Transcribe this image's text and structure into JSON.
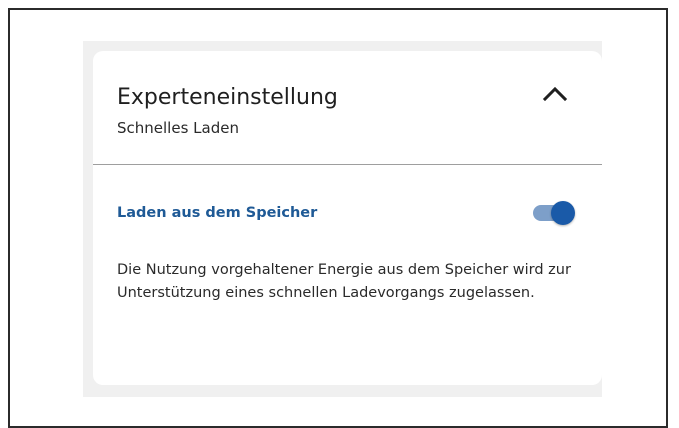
{
  "settings_card": {
    "title": "Experteneinstellung",
    "subtitle": "Schnelles Laden",
    "expanded": true,
    "collapse_icon": "chevron-up-icon",
    "option": {
      "label": "Laden aus dem Speicher",
      "enabled": true,
      "description": "Die Nutzung vorgehaltener Energie aus dem Speicher wird zur Unterstützung eines schnellen Ladevorgangs zugelassen."
    }
  },
  "colors": {
    "accent": "#1a5aa8",
    "accent_text": "#1f5a96",
    "toggle_track": "#7d9fc9",
    "divider": "#9e9e9e",
    "card_backdrop": "#f0f0f0",
    "frame_border": "#2b2b2b"
  }
}
